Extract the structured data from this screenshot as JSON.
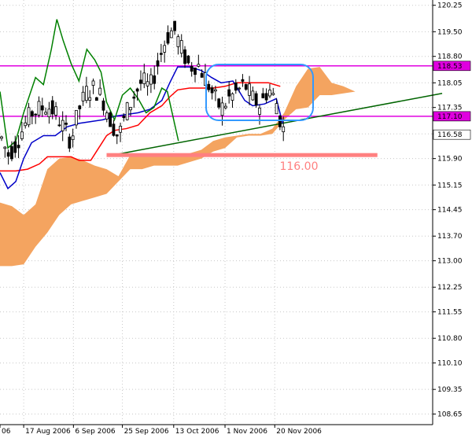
{
  "chart_data": {
    "type": "candlestick",
    "y_axis": {
      "ylim": [
        108.35,
        120.4
      ],
      "ticks": [
        "120.25",
        "119.50",
        "118.80",
        "118.05",
        "117.35",
        "116.60",
        "115.90",
        "115.15",
        "114.45",
        "113.70",
        "113.00",
        "112.25",
        "111.55",
        "110.80",
        "110.10",
        "109.35",
        "108.65"
      ],
      "tick_values": [
        120.25,
        119.5,
        118.8,
        118.05,
        117.35,
        116.6,
        115.9,
        115.15,
        114.45,
        113.7,
        113.0,
        112.25,
        111.55,
        110.8,
        110.1,
        109.35,
        108.65
      ]
    },
    "x_axis": {
      "xlim": [
        0,
        548
      ],
      "labels": [
        {
          "text": "06",
          "x": 0
        },
        {
          "text": "17 Aug 2006",
          "x": 30
        },
        {
          "text": "6 Sep 2006",
          "x": 93
        },
        {
          "text": "25 Sep 2006",
          "x": 155
        },
        {
          "text": "13 Oct 2006",
          "x": 220
        },
        {
          "text": "1 Nov 2006",
          "x": 285
        },
        {
          "text": "20 Nov 2006",
          "x": 348
        }
      ]
    },
    "price_markers": [
      {
        "label": "118.53",
        "value": 118.53,
        "color": "#e000e0"
      },
      {
        "label": "117.10",
        "value": 117.1,
        "color": "#e000e0"
      },
      {
        "label": "116.58",
        "value": 116.58,
        "color": "#ffffff"
      }
    ],
    "horizontal_lines": [
      {
        "value": 118.53,
        "color": "#e000e0"
      },
      {
        "value": 117.1,
        "color": "#e000e0"
      }
    ],
    "support_level": {
      "label": "116.00",
      "value": 116.0,
      "x_start": 135,
      "x_end": 478,
      "color": "#ff8080"
    },
    "trendline": {
      "points": [
        [
          150,
          116.03
        ],
        [
          560,
          117.75
        ]
      ],
      "color": "#006400"
    },
    "cloud": {
      "color": "#f4a460",
      "x": [
        0,
        15,
        30,
        45,
        60,
        75,
        90,
        105,
        120,
        135,
        150,
        165,
        180,
        195,
        210,
        225,
        240,
        255,
        270,
        285,
        300,
        315,
        330,
        345,
        360,
        375,
        390,
        405,
        420,
        435,
        450,
        465
      ],
      "upper": [
        114.65,
        114.55,
        114.3,
        114.6,
        115.6,
        115.9,
        115.95,
        115.85,
        115.7,
        115.6,
        115.4,
        116.0,
        115.95,
        115.95,
        115.95,
        116.05,
        116.05,
        116.15,
        116.4,
        116.5,
        116.55,
        116.6,
        116.6,
        116.75,
        117.2,
        117.95,
        118.45,
        118.5,
        118.05,
        117.95,
        117.8,
        117.8
      ],
      "lower": [
        112.85,
        112.85,
        112.9,
        113.4,
        113.8,
        114.3,
        114.6,
        114.7,
        114.8,
        114.9,
        115.25,
        115.6,
        115.6,
        115.7,
        115.7,
        115.7,
        115.8,
        115.9,
        116.1,
        116.2,
        116.5,
        116.55,
        116.55,
        116.6,
        117.0,
        117.3,
        117.35,
        117.7,
        117.7,
        117.75,
        117.8,
        117.8
      ]
    },
    "series": [
      {
        "color": "#ff0000",
        "x": [
          0,
          20,
          35,
          50,
          60,
          75,
          90,
          100,
          115,
          125,
          135,
          145,
          160,
          175,
          190,
          205,
          215,
          225,
          240,
          255,
          270,
          285,
          300,
          320,
          340,
          355
        ],
        "y": [
          115.55,
          115.55,
          115.6,
          115.75,
          115.95,
          115.95,
          115.95,
          115.85,
          115.85,
          116.2,
          116.55,
          116.7,
          116.75,
          116.85,
          117.2,
          117.4,
          117.65,
          117.85,
          117.9,
          117.9,
          117.9,
          117.95,
          118.05,
          118.05,
          118.05,
          117.95
        ]
      },
      {
        "color": "#0000c8",
        "x": [
          0,
          10,
          20,
          30,
          40,
          55,
          70,
          85,
          100,
          115,
          130,
          145,
          160,
          175,
          190,
          205,
          215,
          225,
          240,
          255,
          268,
          280,
          295,
          310,
          320,
          335,
          350,
          358
        ],
        "y": [
          115.5,
          115.05,
          115.25,
          115.9,
          116.35,
          116.55,
          116.55,
          116.8,
          116.9,
          116.95,
          117.0,
          117.1,
          117.15,
          117.2,
          117.3,
          117.55,
          118.05,
          118.5,
          118.5,
          118.4,
          118.2,
          118.05,
          118.1,
          117.55,
          117.4,
          117.45,
          117.6,
          116.9
        ]
      },
      {
        "color": "#008000",
        "x": [
          0,
          10,
          20,
          30,
          45,
          55,
          65,
          72,
          80,
          90,
          100,
          110,
          120,
          128,
          135,
          145,
          155,
          165,
          175,
          185,
          195,
          205,
          212,
          220,
          226
        ],
        "y": [
          117.8,
          116.2,
          116.4,
          117.2,
          118.2,
          118.0,
          119.0,
          119.85,
          119.25,
          118.6,
          118.1,
          119.0,
          118.7,
          118.35,
          117.5,
          117.0,
          117.7,
          117.9,
          117.6,
          117.2,
          117.35,
          117.9,
          117.8,
          117.0,
          116.4
        ]
      }
    ]
  }
}
